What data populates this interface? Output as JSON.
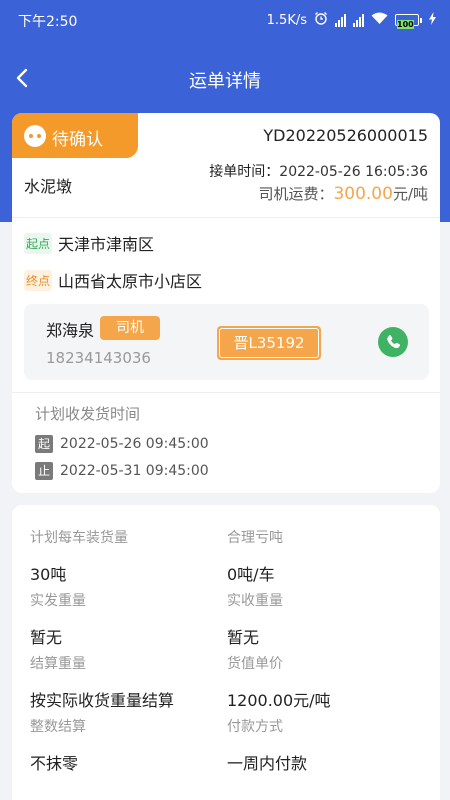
{
  "status_bar": {
    "time": "下午2:50",
    "net_speed": "1.5K/s",
    "battery": "100"
  },
  "nav": {
    "title": "运单详情"
  },
  "order": {
    "status": "待确认",
    "number": "YD20220526000015",
    "cargo": "水泥墩",
    "accept_time_label": "接单时间：",
    "accept_time": "2022-05-26 16:05:36",
    "fee_label": "司机运费：",
    "fee_amount": "300.00",
    "fee_unit": "元/吨"
  },
  "route": {
    "start_tag": "起点",
    "start": "天津市津南区",
    "end_tag": "终点",
    "end": "山西省太原市小店区"
  },
  "driver": {
    "name": "郑海泉",
    "role": "司机",
    "phone": "18234143036",
    "plate": "晋L35192"
  },
  "plan": {
    "title": "计划收发货时间",
    "start_tag": "起",
    "start": "2022-05-26 09:45:00",
    "end_tag": "止",
    "end": "2022-05-31 09:45:00"
  },
  "details": [
    {
      "label": "计划每车装货量",
      "value": "30吨"
    },
    {
      "label": "合理亏吨",
      "value": "0吨/车"
    },
    {
      "label": "实发重量",
      "value": "暂无"
    },
    {
      "label": "实收重量",
      "value": "暂无"
    },
    {
      "label": "结算重量",
      "value": "按实际收货重量结算"
    },
    {
      "label": "货值单价",
      "value": "1200.00元/吨"
    },
    {
      "label": "整数结算",
      "value": "不抹零"
    },
    {
      "label": "付款方式",
      "value": "一周内付款"
    }
  ],
  "colors": {
    "header_blue": "#3b62d6",
    "accent_orange": "#f39a2b",
    "call_green": "#3eb363"
  }
}
